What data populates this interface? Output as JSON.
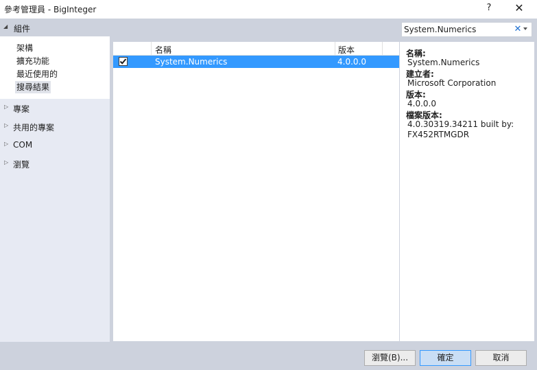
{
  "window": {
    "title": "參考管理員 - BigInteger",
    "help_label": "?",
    "close_label": "✕"
  },
  "sidebar": {
    "group_label": "組件",
    "subitems": [
      "架構",
      "擴充功能",
      "最近使用的",
      "搜尋結果"
    ],
    "selected_subitem": "搜尋結果",
    "nodes": [
      "專案",
      "共用的專案",
      "COM",
      "瀏覽"
    ]
  },
  "search": {
    "value": "System.Numerics",
    "clear_icon": "close-icon",
    "dropdown_icon": "dropdown-arrow-icon"
  },
  "list": {
    "columns": [
      "名稱",
      "版本"
    ],
    "rows": [
      {
        "checked": true,
        "name": "System.Numerics",
        "version": "4.0.0.0"
      }
    ]
  },
  "details": {
    "name_label": "名稱:",
    "name_value": "System.Numerics",
    "creator_label": "建立者:",
    "creator_value": "Microsoft Corporation",
    "version_label": "版本:",
    "version_value": "4.0.0.0",
    "file_version_label": "檔案版本:",
    "file_version_value_line1": "4.0.30319.34211 built by:",
    "file_version_value_line2": "FX452RTMGDR"
  },
  "buttons": {
    "browse": "瀏覽(B)...",
    "ok": "確定",
    "cancel": "取消"
  },
  "colors": {
    "accent": "#3399ff",
    "panel_bg": "#cdd2dd",
    "sidebar_bg": "#e7eaf3"
  }
}
